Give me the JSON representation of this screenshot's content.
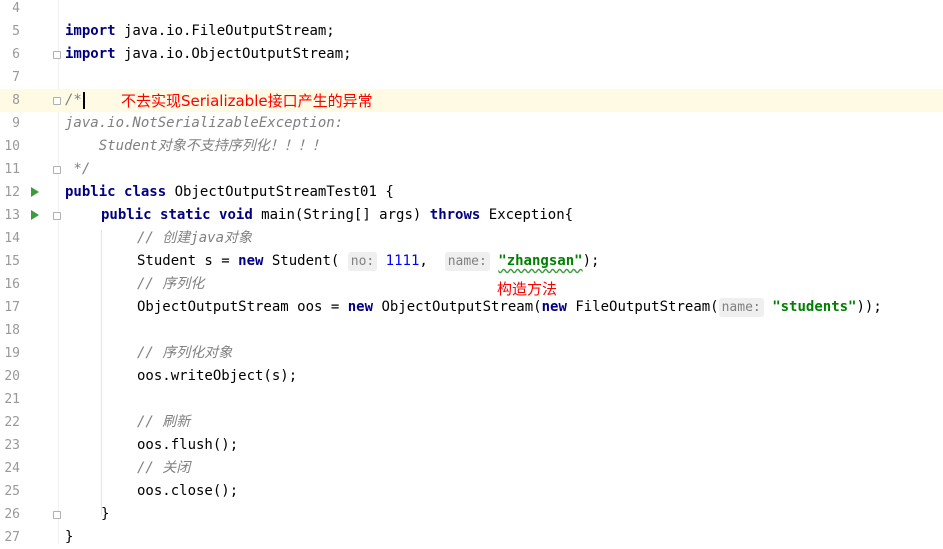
{
  "lines": [
    {
      "num": "4"
    },
    {
      "num": "5",
      "kw": "import",
      "rest": " java.io.FileOutputStream;"
    },
    {
      "num": "6",
      "kw": "import",
      "rest": " java.io.ObjectOutputStream;"
    },
    {
      "num": "7"
    },
    {
      "num": "8",
      "comment": "/*"
    },
    {
      "num": "9",
      "comment": "java.io.NotSerializableException:"
    },
    {
      "num": "10",
      "comment": "    Student对象不支持序列化！！！！"
    },
    {
      "num": "11",
      "comment": " */"
    },
    {
      "num": "12",
      "kw1": "public",
      "kw2": "class",
      "rest": " ObjectOutputStreamTest01 {"
    },
    {
      "num": "13",
      "kw1": "public",
      "kw2": "static",
      "kw3": "void",
      "mid": " main(String[] args) ",
      "kw4": "throws",
      "rest": " Exception{"
    },
    {
      "num": "14",
      "comment": "// 创建java对象"
    },
    {
      "num": "15",
      "pre": "Student s = ",
      "kw": "new",
      "mid": " Student(",
      "hint1": "no:",
      "val1": "1111",
      "sep": ", ",
      "hint2": "name:",
      "str": "\"zhangsan\"",
      "post": ");"
    },
    {
      "num": "16",
      "comment": "// 序列化"
    },
    {
      "num": "17",
      "pre": "ObjectOutputStream oos = ",
      "kw": "new",
      "mid": " ObjectOutputStream(",
      "kw2": "new",
      "mid2": " FileOutputStream(",
      "hint": "name:",
      "str": "\"students\"",
      "post": "));"
    },
    {
      "num": "18"
    },
    {
      "num": "19",
      "comment": "// 序列化对象"
    },
    {
      "num": "20",
      "code": "oos.writeObject(s);"
    },
    {
      "num": "21"
    },
    {
      "num": "22",
      "comment": "// 刷新"
    },
    {
      "num": "23",
      "code": "oos.flush();"
    },
    {
      "num": "24",
      "comment": "// 关闭"
    },
    {
      "num": "25",
      "code": "oos.close();"
    },
    {
      "num": "26",
      "code": "}"
    },
    {
      "num": "27",
      "code": "}"
    }
  ],
  "annotations": {
    "line8_note": "不去实现Serializable接口产生的异常",
    "constructor_note": "构造方法"
  },
  "colors": {
    "keyword": "#000080",
    "comment": "#808080",
    "string": "#008000",
    "number": "#0000ff",
    "annotation": "#ff0000",
    "current_line": "#fffae3",
    "run_icon": "#3d9b3d"
  }
}
